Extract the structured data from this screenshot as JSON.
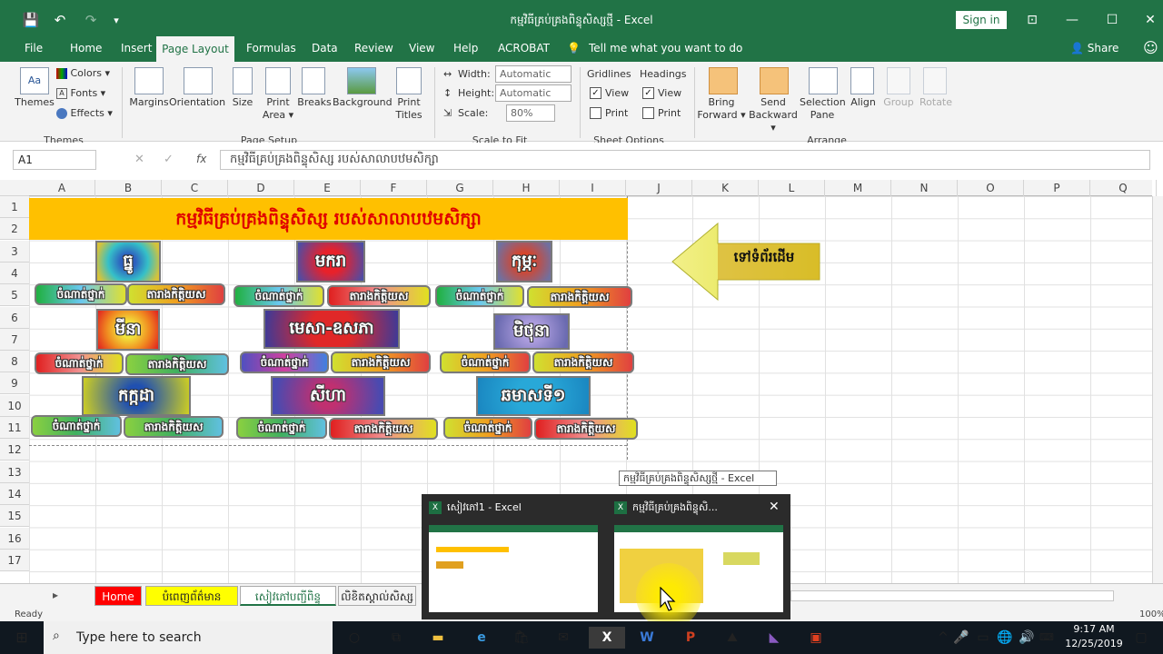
{
  "window": {
    "title": "កម្មវិធីគ្រប់គ្រងពិន្ទុសិស្សថ្មី - Excel",
    "signin": "Sign in",
    "min": "—",
    "max": "☐",
    "close": "✕",
    "ribbon_display": "⊡"
  },
  "qat": {
    "save": "💾",
    "undo": "↶",
    "redo": "↷",
    "customize": "▾"
  },
  "menu": {
    "file": "File",
    "home": "Home",
    "insert": "Insert",
    "page_layout": "Page Layout",
    "formulas": "Formulas",
    "data": "Data",
    "review": "Review",
    "view": "View",
    "help": "Help",
    "acrobat": "ACROBAT",
    "tell_me": "Tell me what you want to do",
    "share": "Share",
    "smiley": "☺"
  },
  "ribbon": {
    "themes": "Themes",
    "colors": "Colors ▾",
    "fonts": "Fonts ▾",
    "effects": "Effects ▾",
    "group_themes": "Themes",
    "margins": "Margins",
    "orientation": "Orientation",
    "size": "Size",
    "print_area": "Print Area ▾",
    "breaks": "Breaks",
    "background": "Background",
    "print_titles": "Print Titles",
    "group_page_setup": "Page Setup",
    "width_label": "Width:",
    "width_value": "Automatic",
    "height_label": "Height:",
    "height_value": "Automatic",
    "scale_label": "Scale:",
    "scale_value": "80%",
    "group_scale": "Scale to Fit",
    "gridlines": "Gridlines",
    "headings": "Headings",
    "view": "View",
    "print": "Print",
    "group_sheet_options": "Sheet Options",
    "bring_forward": "Bring Forward ▾",
    "send_backward": "Send Backward ▾",
    "selection_pane": "Selection Pane",
    "align": "Align",
    "group": "Group",
    "rotate": "Rotate",
    "group_arrange": "Arrange"
  },
  "formula_bar": {
    "name_box": "A1",
    "cancel": "✕",
    "enter": "✓",
    "fx": "fx",
    "content": "កម្មវិធីគ្រប់គ្រងពិន្ទុសិស្ស របស់សាលាបឋមសិក្សា"
  },
  "columns": [
    "A",
    "B",
    "C",
    "D",
    "E",
    "F",
    "G",
    "H",
    "I",
    "J",
    "K",
    "L",
    "M",
    "N",
    "O",
    "P",
    "Q"
  ],
  "rows": [
    "1",
    "2",
    "3",
    "4",
    "5",
    "6",
    "7",
    "8",
    "9",
    "10",
    "11",
    "12",
    "13",
    "14",
    "15",
    "16",
    "17"
  ],
  "sheet": {
    "title_band": "កម្មវិធីគ្រប់គ្រងពិន្ទុសិស្ស របស់សាលាបឋមសិក្សា",
    "arrow_label": "ទៅទំព័រដើម",
    "signs": {
      "s1": "ធ្នូ",
      "s2": "មករា",
      "s3": "កុម្ភៈ",
      "s4": "មីនា",
      "s5": "មេសា-ឧសភា",
      "s6": "មិថុនា",
      "s7": "កក្កដា",
      "s8": "សីហា",
      "s9": "ឆមាសទី១"
    },
    "btn_rank": "ចំណាត់ថ្នាក់",
    "btn_result": "តារាងកិត្តិយស"
  },
  "tabs": {
    "nav": "▸",
    "home": "Home",
    "t2": "បំពេញព័ត៌មាន",
    "t3": "សៀវភៅបញ្ជីពិន្ទុ",
    "t4": "លិខិតស្គាល់សិស្ស"
  },
  "status": {
    "ready": "Ready",
    "zoom": "100%"
  },
  "taskview": {
    "tooltip": "កម្មវិធីគ្រប់គ្រងពិន្ទុសិស្សថ្មី - Excel",
    "thumb1_title": "សៀវភៅ1 - Excel",
    "thumb2_title": "កម្មវិធីគ្រប់គ្រងពិន្ទុសិ...",
    "thumb2_close": "✕"
  },
  "taskbar": {
    "search_placeholder": "Type here to search",
    "time": "9:17 AM",
    "date": "12/25/2019"
  },
  "colors": {
    "excel_green": "#217346",
    "title_gold": "#ffc000",
    "title_red": "#e00000"
  }
}
